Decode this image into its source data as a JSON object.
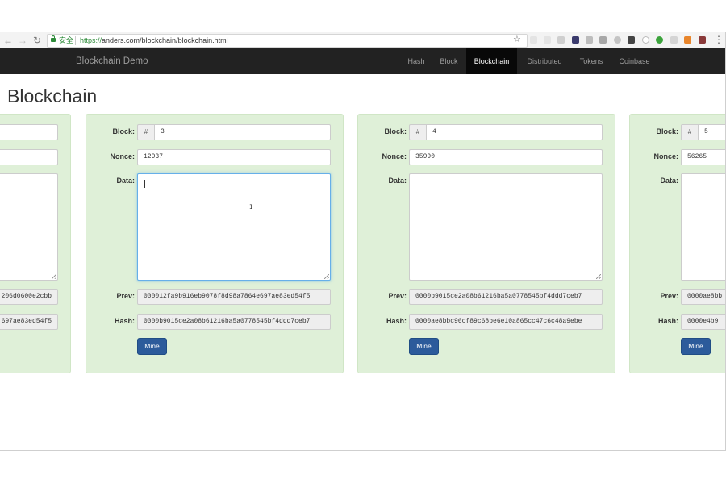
{
  "browser": {
    "secure_label": "安全",
    "url_scheme": "https://",
    "url_rest": "anders.com/blockchain/blockchain.html"
  },
  "navbar": {
    "brand": "Blockchain Demo",
    "items": [
      {
        "label": "Hash"
      },
      {
        "label": "Block"
      },
      {
        "label": "Blockchain"
      },
      {
        "label": "Distributed"
      },
      {
        "label": "Tokens"
      },
      {
        "label": "Coinbase"
      }
    ],
    "active": "Blockchain"
  },
  "page": {
    "title": "Blockchain"
  },
  "labels": {
    "block": "Block:",
    "nonce": "Nonce:",
    "data": "Data:",
    "prev": "Prev:",
    "hash": "Hash:",
    "mine": "Mine",
    "hash_sign": "#"
  },
  "blocks": [
    {
      "prev": "206d0600e2cbb",
      "hash": "697ae83ed54f5"
    },
    {
      "number": "3",
      "nonce": "12937",
      "data": "",
      "prev": "000012fa9b916eb9078f8d98a7864e697ae83ed54f5",
      "hash": "0000b9015ce2a08b61216ba5a0778545bf4ddd7ceb7"
    },
    {
      "number": "4",
      "nonce": "35990",
      "data": "",
      "prev": "0000b9015ce2a08b61216ba5a0778545bf4ddd7ceb7",
      "hash": "0000ae8bbc96cf89c68be6e10a865cc47c6c48a9ebe"
    },
    {
      "number": "5",
      "nonce": "56265",
      "data": "",
      "prev": "0000ae8bb",
      "hash": "0000e4b9"
    }
  ],
  "colors": {
    "card_bg": "#dff0d8",
    "navbar_bg": "#222222",
    "mine_button": "#2c5b9b"
  }
}
